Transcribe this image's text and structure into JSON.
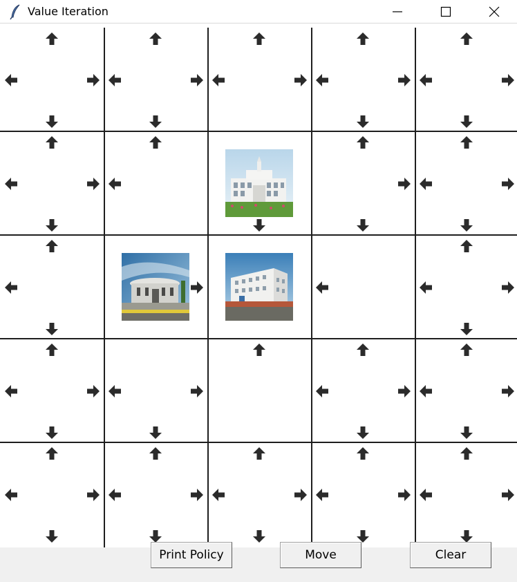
{
  "window": {
    "title": "Value Iteration",
    "app_icon": "feather-icon",
    "controls": [
      "minimize-icon",
      "maximize-icon",
      "close-icon"
    ]
  },
  "grid": {
    "rows": 5,
    "cols": 5,
    "line_color": "#1e1e1e",
    "arrow_color": "#2b2b2b",
    "cells": [
      [
        [
          "up",
          "down",
          "left",
          "right"
        ],
        [
          "up",
          "down",
          "left",
          "right"
        ],
        [
          "up",
          "left",
          "right"
        ],
        [
          "up",
          "down",
          "left",
          "right"
        ],
        [
          "up",
          "down",
          "left",
          "right"
        ]
      ],
      [
        [
          "up",
          "down",
          "left",
          "right"
        ],
        [
          "up",
          "left"
        ],
        [
          "down"
        ],
        [
          "up",
          "down",
          "right"
        ],
        [
          "up",
          "down",
          "left",
          "right"
        ]
      ],
      [
        [
          "up",
          "down",
          "left"
        ],
        [
          "right"
        ],
        [],
        [
          "left"
        ],
        [
          "up",
          "down",
          "left",
          "right"
        ]
      ],
      [
        [
          "up",
          "down",
          "left",
          "right"
        ],
        [
          "down",
          "left",
          "right"
        ],
        [
          "up"
        ],
        [
          "up",
          "down",
          "left",
          "right"
        ],
        [
          "up",
          "down",
          "left",
          "right"
        ]
      ],
      [
        [
          "up",
          "down",
          "left",
          "right"
        ],
        [
          "up",
          "down",
          "left",
          "right"
        ],
        [
          "up",
          "down",
          "left",
          "right"
        ],
        [
          "up",
          "down",
          "left",
          "right"
        ],
        [
          "up",
          "down",
          "left",
          "right"
        ]
      ]
    ],
    "images": [
      {
        "row": 1,
        "col": 2,
        "name": "building-photo-white-tower"
      },
      {
        "row": 2,
        "col": 1,
        "name": "building-photo-rotunda"
      },
      {
        "row": 2,
        "col": 2,
        "name": "building-photo-white-block"
      }
    ]
  },
  "buttons": {
    "print_policy": "Print Policy",
    "move": "Move",
    "clear": "Clear"
  }
}
